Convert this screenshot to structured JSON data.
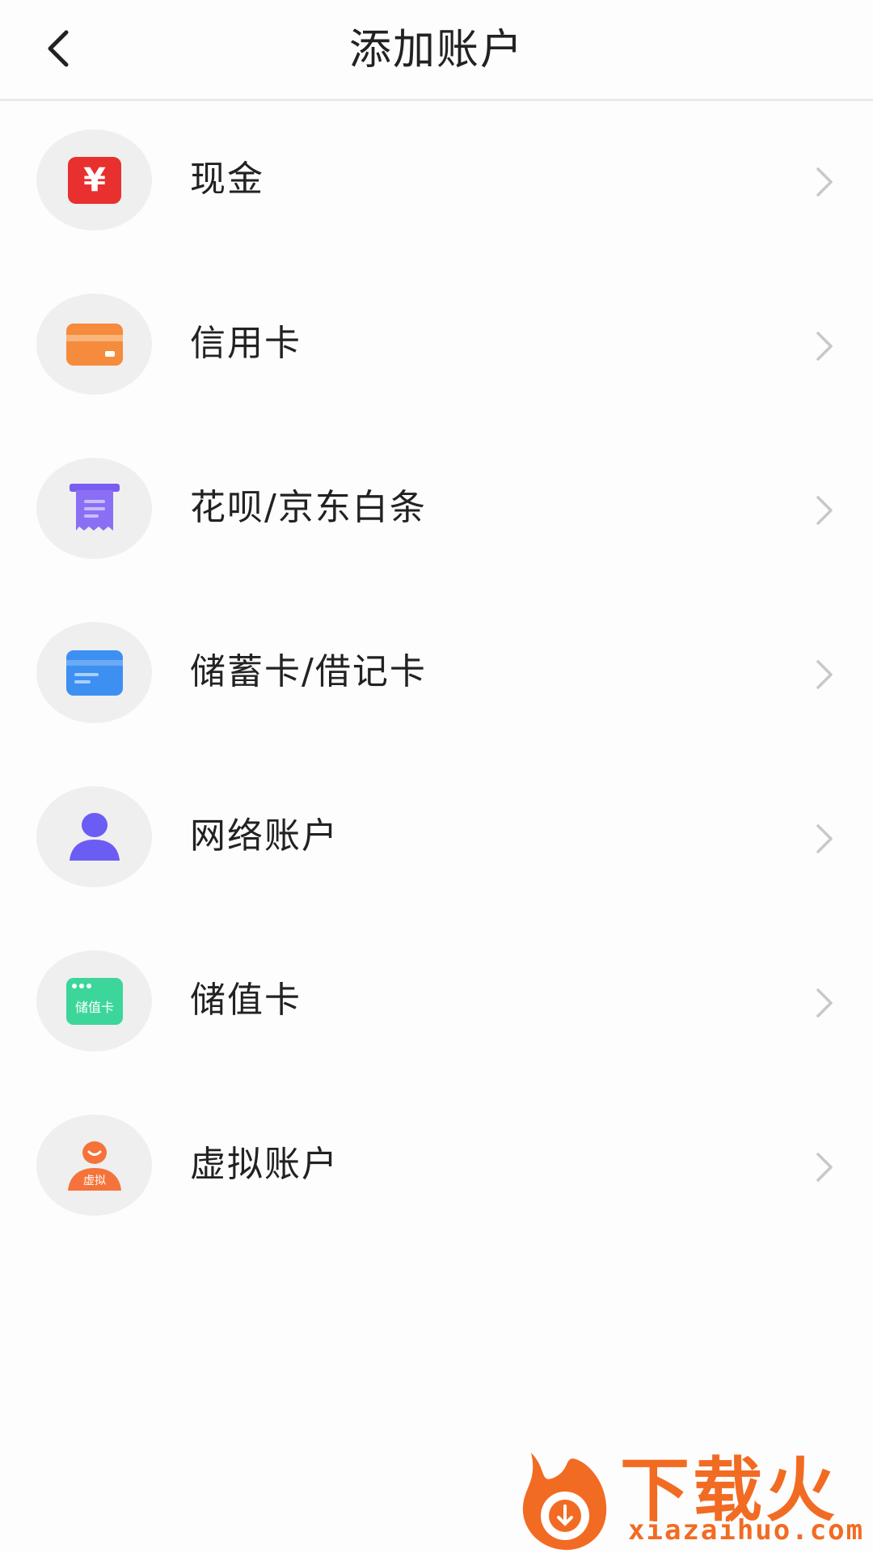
{
  "header": {
    "title": "添加账户"
  },
  "accounts": [
    {
      "label": "现金",
      "icon": "cash-icon"
    },
    {
      "label": "信用卡",
      "icon": "credit-card-icon"
    },
    {
      "label": "花呗/京东白条",
      "icon": "receipt-icon"
    },
    {
      "label": "储蓄卡/借记卡",
      "icon": "debit-card-icon"
    },
    {
      "label": "网络账户",
      "icon": "user-icon"
    },
    {
      "label": "储值卡",
      "icon": "stored-value-card-icon",
      "icon_text": "储值卡"
    },
    {
      "label": "虚拟账户",
      "icon": "virtual-user-icon",
      "icon_text": "虚拟"
    }
  ],
  "watermark": {
    "brand": "下载火",
    "url": "xiazaihuo.com"
  },
  "colors": {
    "cash": "#e8302f",
    "credit": "#f58b3c",
    "receipt": "#7a5cf0",
    "debit": "#3d8ff2",
    "network": "#6b5df3",
    "stored": "#3cd69a",
    "virtual": "#f5733a",
    "watermark": "#f26b23"
  }
}
